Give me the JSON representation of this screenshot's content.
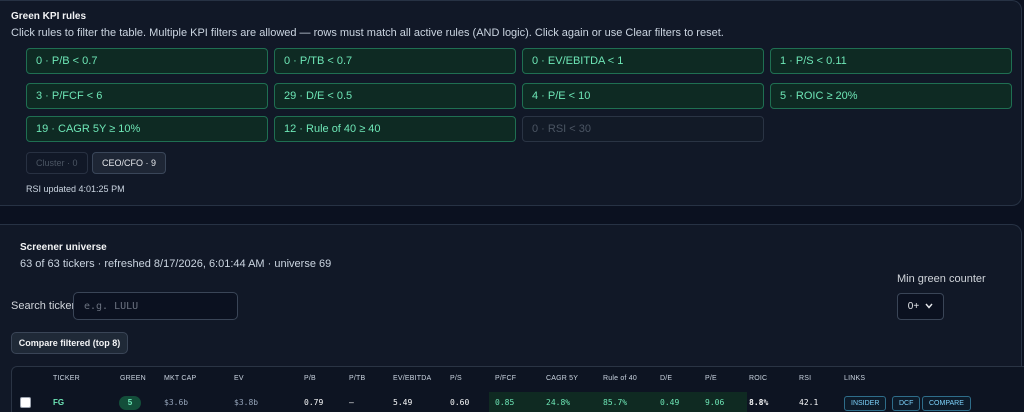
{
  "kpi": {
    "title": "Green KPI rules",
    "description": "Click rules to filter the table. Multiple KPI filters are allowed — rows must match all active rules (AND logic). Click again or use Clear filters to reset.",
    "rules": [
      {
        "label": "0 · P/B < 0.7"
      },
      {
        "label": "0 · P/TB < 0.7"
      },
      {
        "label": "0 · EV/EBITDA < 1"
      },
      {
        "label": "1 · P/S < 0.11"
      },
      {
        "label": "3 · P/FCF < 6"
      },
      {
        "label": "29 · D/E < 0.5"
      },
      {
        "label": "4 · P/E < 10"
      },
      {
        "label": "5 · ROIC ≥ 20%"
      },
      {
        "label": "19 · CAGR 5Y ≥ 10%"
      },
      {
        "label": "12 · Rule of 40 ≥ 40"
      },
      {
        "label": "0 · RSI < 30"
      }
    ],
    "chips": [
      {
        "label": "Cluster · 0"
      },
      {
        "label": "CEO/CFO · 9"
      }
    ],
    "rsi_updated": "RSI updated 4:01:25 PM"
  },
  "screener": {
    "title": "Screener universe",
    "summary": "63 of 63 tickers · refreshed 8/17/2026, 6:01:44 AM · universe 69",
    "search_label": "Search ticker",
    "search_placeholder": "e.g. LULU",
    "min_green_label": "Min green counter",
    "min_green_value": "0+",
    "compare_button": "Compare filtered (top 8)"
  },
  "table": {
    "headers": [
      "TICKER",
      "GREEN",
      "MKT CAP",
      "EV",
      "P/B",
      "P/TB",
      "EV/EBITDA",
      "P/S",
      "P/FCF",
      "CAGR 5Y",
      "Rule of 40",
      "D/E",
      "P/E",
      "ROIC",
      "RSI",
      "LINKS"
    ],
    "rows": [
      {
        "ticker": "FG",
        "green": "5",
        "mkt_cap": "$3.6b",
        "ev": "$3.8b",
        "pb": "0.79",
        "ptb": "—",
        "ev_ebitda": "5.49",
        "ps": "0.60",
        "pfcf": "0.85",
        "cagr": "24.8%",
        "rule40": "85.7%",
        "de": "0.49",
        "pe": "9.06",
        "roic": "8.8%",
        "rsi": "42.1",
        "links": [
          "INSIDER",
          "DCF",
          "COMPARE"
        ]
      }
    ]
  }
}
